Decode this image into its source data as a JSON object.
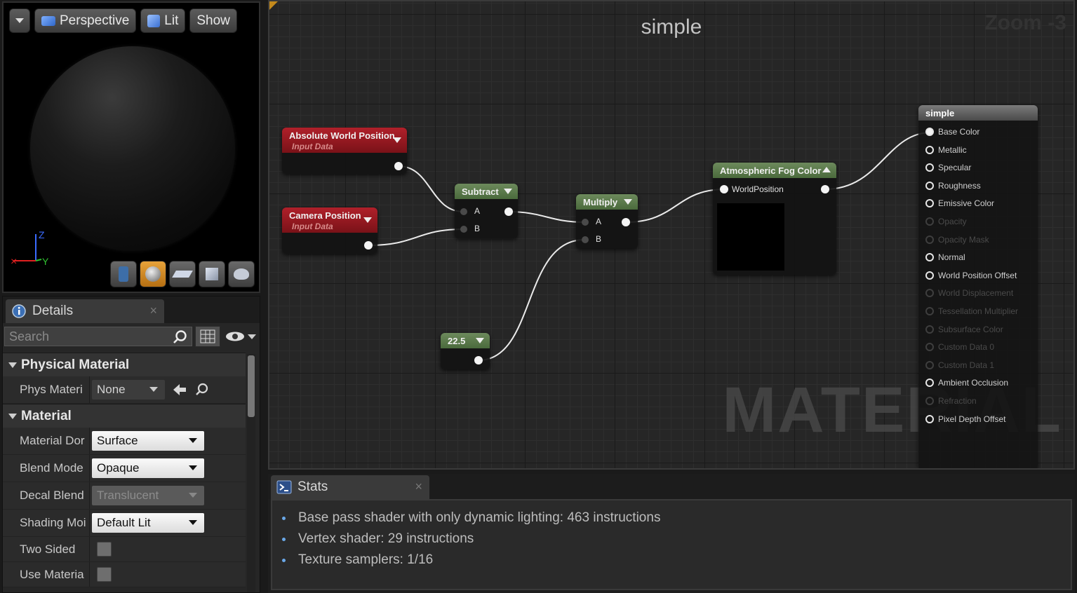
{
  "viewport": {
    "toolbar": {
      "perspective": "Perspective",
      "lit": "Lit",
      "show": "Show"
    },
    "preview_shapes": [
      "cylinder-icon",
      "sphere-icon",
      "plane-icon",
      "cube-icon",
      "teapot-icon"
    ],
    "active_shape": "sphere-icon",
    "axis": {
      "z": "Z",
      "y": "Y"
    }
  },
  "details": {
    "tab_title": "Details",
    "search_placeholder": "Search",
    "categories": [
      {
        "title": "Physical Material",
        "rows": [
          {
            "label": "Phys Materi",
            "type": "asset",
            "value": "None"
          }
        ]
      },
      {
        "title": "Material",
        "rows": [
          {
            "label": "Material Dor",
            "type": "combo",
            "value": "Surface"
          },
          {
            "label": "Blend Mode",
            "type": "combo",
            "value": "Opaque"
          },
          {
            "label": "Decal Blend",
            "type": "combo-disabled",
            "value": "Translucent"
          },
          {
            "label": "Shading Moi",
            "type": "combo",
            "value": "Default Lit"
          },
          {
            "label": "Two Sided",
            "type": "check",
            "value": false
          },
          {
            "label": "Use Materia",
            "type": "check",
            "value": false
          }
        ]
      }
    ]
  },
  "graph": {
    "title": "simple",
    "zoom": "Zoom -3",
    "watermark": "MATERIAL",
    "nodes": {
      "abs_world": {
        "title": "Absolute World Position",
        "subtitle": "Input Data"
      },
      "camera_pos": {
        "title": "Camera Position",
        "subtitle": "Input Data"
      },
      "subtract": {
        "title": "Subtract",
        "in_a": "A",
        "in_b": "B"
      },
      "multiply": {
        "title": "Multiply",
        "in_a": "A",
        "in_b": "B"
      },
      "constant": {
        "title": "22.5"
      },
      "fog": {
        "title": "Atmospheric Fog Color",
        "in": "WorldPosition"
      }
    },
    "result": {
      "title": "simple",
      "inputs": [
        {
          "label": "Base Color",
          "state": "connected"
        },
        {
          "label": "Metallic",
          "state": "on"
        },
        {
          "label": "Specular",
          "state": "on"
        },
        {
          "label": "Roughness",
          "state": "on"
        },
        {
          "label": "Emissive Color",
          "state": "on"
        },
        {
          "label": "Opacity",
          "state": "off"
        },
        {
          "label": "Opacity Mask",
          "state": "off"
        },
        {
          "label": "Normal",
          "state": "on"
        },
        {
          "label": "World Position Offset",
          "state": "on"
        },
        {
          "label": "World Displacement",
          "state": "off"
        },
        {
          "label": "Tessellation Multiplier",
          "state": "off"
        },
        {
          "label": "Subsurface Color",
          "state": "off"
        },
        {
          "label": "Custom Data 0",
          "state": "off"
        },
        {
          "label": "Custom Data 1",
          "state": "off"
        },
        {
          "label": "Ambient Occlusion",
          "state": "on"
        },
        {
          "label": "Refraction",
          "state": "off"
        },
        {
          "label": "Pixel Depth Offset",
          "state": "on"
        }
      ]
    }
  },
  "stats": {
    "tab_title": "Stats",
    "lines": [
      "Base pass shader with only dynamic lighting: 463 instructions",
      "Vertex shader: 29 instructions",
      "Texture samplers: 1/16"
    ]
  },
  "colors": {
    "input_node": "#b0202a",
    "math_node": "#6d8a5c",
    "accent": "#e7a23a",
    "bullet": "#6aa8e8"
  }
}
